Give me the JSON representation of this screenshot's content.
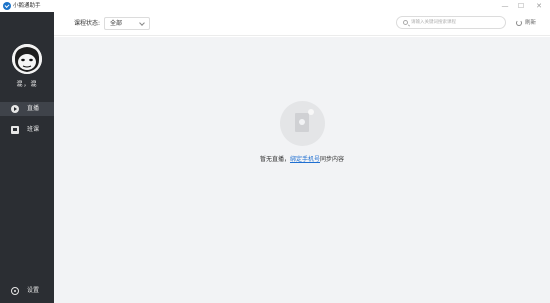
{
  "window": {
    "title": "小鹅通助手",
    "minimize_glyph": "—",
    "maximize_glyph": "☐",
    "close_glyph": "✕"
  },
  "sidebar": {
    "username": "混，混",
    "items": [
      {
        "label": "直播",
        "icon": "play-circle-icon",
        "active": true
      },
      {
        "label": "班课",
        "icon": "class-icon",
        "active": false
      }
    ],
    "settings_label": "设置"
  },
  "toolbar": {
    "filter_label": "课程状态:",
    "filter_value": "全部",
    "search_placeholder": "请输入关键词搜索课程",
    "refresh_label": "刷新"
  },
  "empty_state": {
    "text_before": "暂无直播，",
    "link_text": "绑定手机号",
    "text_after": "同步内容"
  },
  "colors": {
    "sidebar_bg": "#2b2e33",
    "active_item_bg": "#3f434a",
    "main_bg": "#f2f3f5",
    "link": "#1f6fd1"
  }
}
